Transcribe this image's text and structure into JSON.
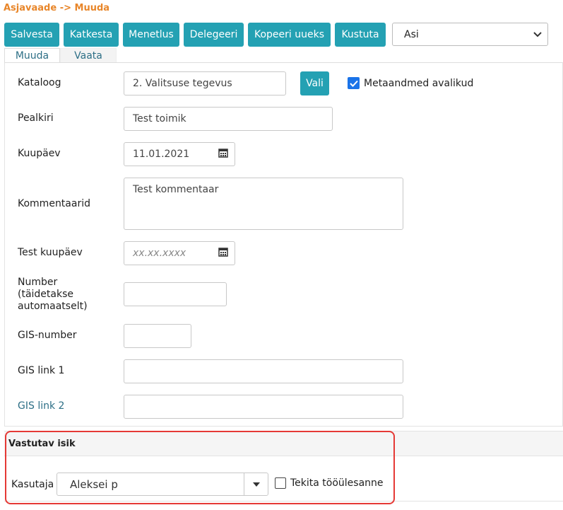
{
  "breadcrumb": "Asjavaade -> Muuda",
  "toolbar": {
    "buttons": [
      "Salvesta",
      "Katkesta",
      "Menetlus",
      "Delegeeri",
      "Kopeeri uueks",
      "Kustuta"
    ],
    "type_select": "Asi"
  },
  "tabs": [
    "Muuda",
    "Vaata"
  ],
  "form": {
    "kataloog": {
      "label": "Kataloog",
      "value": "2. Valitsuse tegevus",
      "button": "Vali",
      "checkbox_label": "Metaandmed avalikud",
      "checkbox_checked": true
    },
    "pealkiri": {
      "label": "Pealkiri",
      "value": "Test toimik"
    },
    "kuupaev": {
      "label": "Kuupäev",
      "value": "11.01.2021"
    },
    "kommentaarid": {
      "label": "Kommentaarid",
      "value": "Test kommentaar"
    },
    "test_kuupaev": {
      "label": "Test kuupäev",
      "placeholder": "xx.xx.xxxx"
    },
    "number": {
      "label_lines": [
        "Number",
        "(täidetakse",
        "automaatselt)"
      ],
      "value": ""
    },
    "gis_number": {
      "label": "GIS-number",
      "value": ""
    },
    "gis_link1": {
      "label": "GIS link 1",
      "value": ""
    },
    "gis_link2": {
      "label": "GIS link 2",
      "value": ""
    }
  },
  "responsible": {
    "header": "Vastutav isik",
    "user_label": "Kasutaja",
    "user_value": "Aleksei p",
    "task_checkbox_label": "Tekita tööülesanne",
    "task_checkbox_checked": false
  },
  "colors": {
    "accent": "#24a1b3",
    "breadcrumb": "#e8862a",
    "highlight": "#e53935",
    "link": "#2d6f86"
  },
  "icons": [
    "calendar-icon",
    "chevron-down-icon",
    "checkmark-icon"
  ]
}
